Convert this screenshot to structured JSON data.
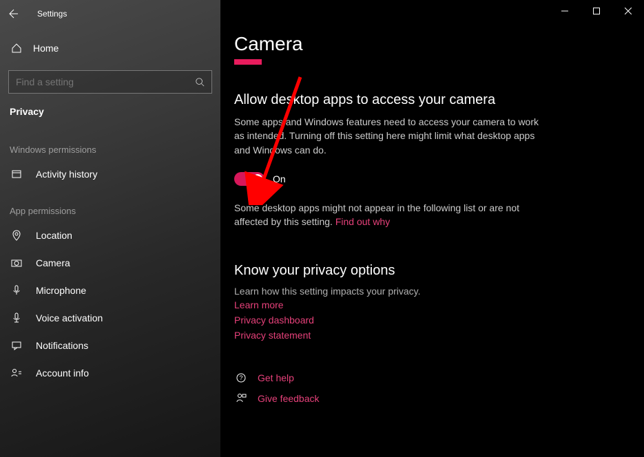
{
  "titlebar": {
    "title": "Settings"
  },
  "sidebar": {
    "home": "Home",
    "search_placeholder": "Find a setting",
    "category": "Privacy",
    "sections": {
      "windows_permissions": "Windows permissions",
      "app_permissions": "App permissions"
    },
    "windows_items": [
      {
        "label": "Activity history"
      }
    ],
    "app_items": [
      {
        "label": "Location"
      },
      {
        "label": "Camera"
      },
      {
        "label": "Microphone"
      },
      {
        "label": "Voice activation"
      },
      {
        "label": "Notifications"
      },
      {
        "label": "Account info"
      }
    ]
  },
  "main": {
    "page_title": "Camera",
    "allow_title": "Allow desktop apps to access your camera",
    "allow_body": "Some apps and Windows features need to access your camera to work as intended. Turning off this setting here might limit what desktop apps and Windows can do.",
    "toggle_state": "On",
    "list_note": "Some desktop apps might not appear in the following list or are not affected by this setting. ",
    "find_out_why": "Find out why",
    "privacy_title": "Know your privacy options",
    "privacy_sub": "Learn how this setting impacts your privacy.",
    "links": {
      "learn_more": "Learn more",
      "dashboard": "Privacy dashboard",
      "statement": "Privacy statement"
    },
    "help": "Get help",
    "feedback": "Give feedback"
  }
}
